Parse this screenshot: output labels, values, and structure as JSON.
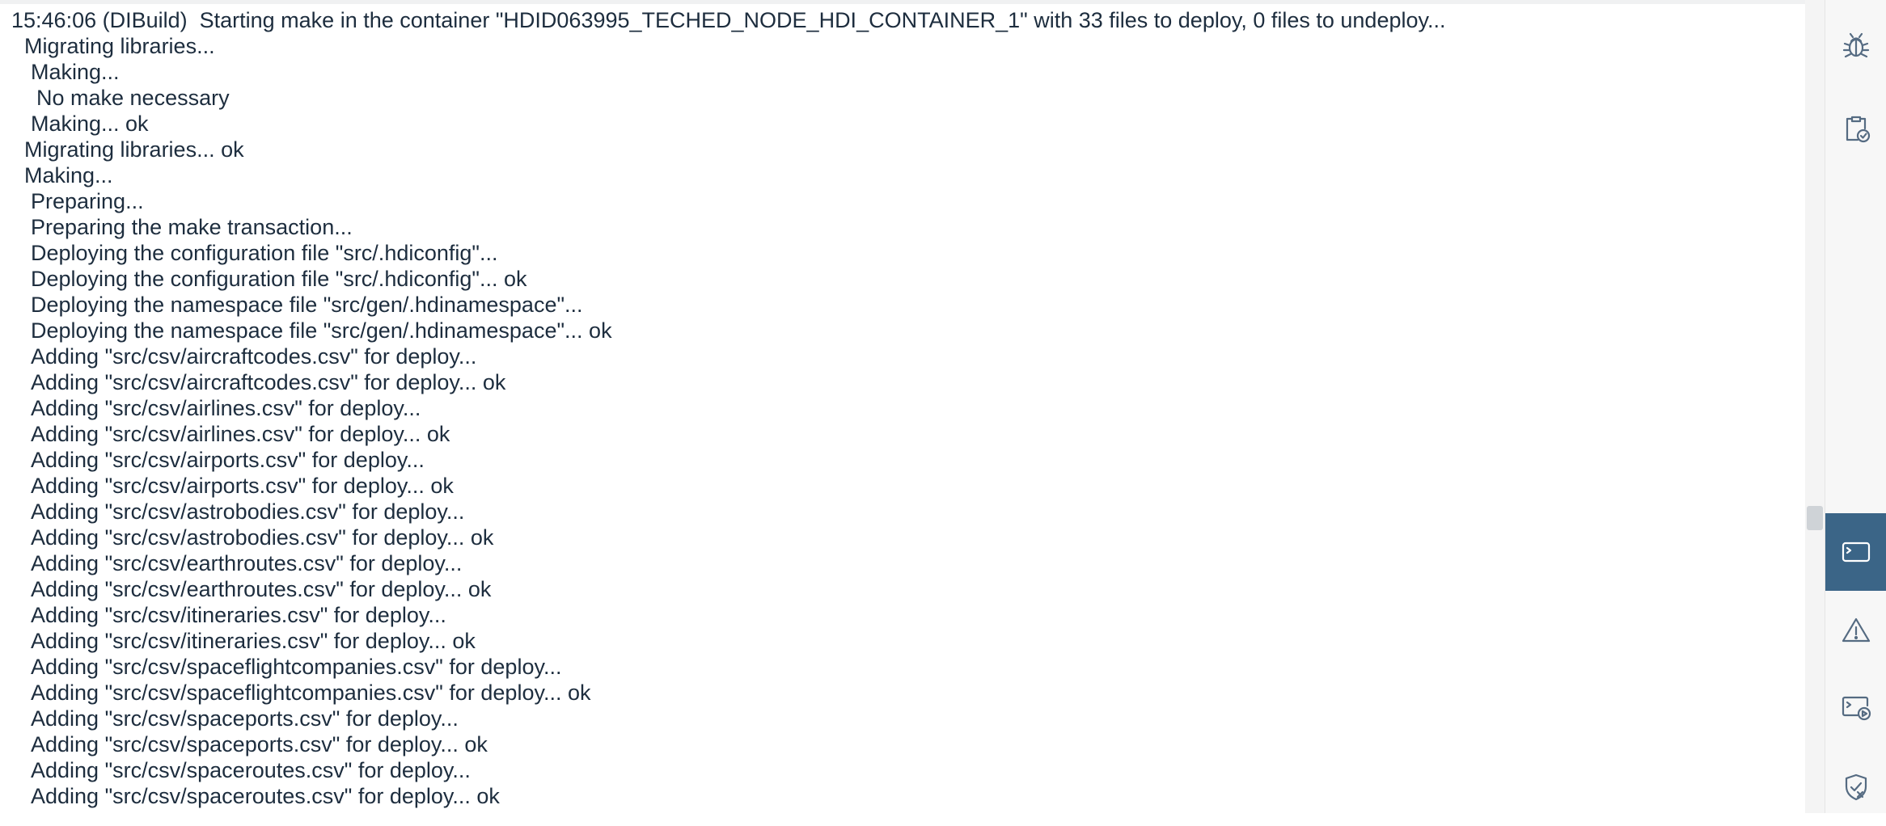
{
  "console": {
    "lines": [
      {
        "text": "15:46:06 (DIBuild)  Starting make in the container \"HDID063995_TECHED_NODE_HDI_CONTAINER_1\" with 33 files to deploy, 0 files to undeploy...",
        "indent": 0
      },
      {
        "text": "Migrating libraries...",
        "indent": 1
      },
      {
        "text": "Making...",
        "indent": 2
      },
      {
        "text": "No make necessary",
        "indent": 3
      },
      {
        "text": "Making... ok",
        "indent": 2
      },
      {
        "text": "Migrating libraries... ok",
        "indent": 1
      },
      {
        "text": "Making...",
        "indent": 1
      },
      {
        "text": "Preparing...",
        "indent": 2
      },
      {
        "text": "Preparing the make transaction...",
        "indent": 2
      },
      {
        "text": "Deploying the configuration file \"src/.hdiconfig\"...",
        "indent": 2
      },
      {
        "text": "Deploying the configuration file \"src/.hdiconfig\"... ok",
        "indent": 2
      },
      {
        "text": "Deploying the namespace file \"src/gen/.hdinamespace\"...",
        "indent": 2
      },
      {
        "text": "Deploying the namespace file \"src/gen/.hdinamespace\"... ok",
        "indent": 2
      },
      {
        "text": "Adding \"src/csv/aircraftcodes.csv\" for deploy...",
        "indent": 2
      },
      {
        "text": "Adding \"src/csv/aircraftcodes.csv\" for deploy... ok",
        "indent": 2
      },
      {
        "text": "Adding \"src/csv/airlines.csv\" for deploy...",
        "indent": 2
      },
      {
        "text": "Adding \"src/csv/airlines.csv\" for deploy... ok",
        "indent": 2
      },
      {
        "text": "Adding \"src/csv/airports.csv\" for deploy...",
        "indent": 2
      },
      {
        "text": "Adding \"src/csv/airports.csv\" for deploy... ok",
        "indent": 2
      },
      {
        "text": "Adding \"src/csv/astrobodies.csv\" for deploy...",
        "indent": 2
      },
      {
        "text": "Adding \"src/csv/astrobodies.csv\" for deploy... ok",
        "indent": 2
      },
      {
        "text": "Adding \"src/csv/earthroutes.csv\" for deploy...",
        "indent": 2
      },
      {
        "text": "Adding \"src/csv/earthroutes.csv\" for deploy... ok",
        "indent": 2
      },
      {
        "text": "Adding \"src/csv/itineraries.csv\" for deploy...",
        "indent": 2
      },
      {
        "text": "Adding \"src/csv/itineraries.csv\" for deploy... ok",
        "indent": 2
      },
      {
        "text": "Adding \"src/csv/spaceflightcompanies.csv\" for deploy...",
        "indent": 2
      },
      {
        "text": "Adding \"src/csv/spaceflightcompanies.csv\" for deploy... ok",
        "indent": 2
      },
      {
        "text": "Adding \"src/csv/spaceports.csv\" for deploy...",
        "indent": 2
      },
      {
        "text": "Adding \"src/csv/spaceports.csv\" for deploy... ok",
        "indent": 2
      },
      {
        "text": "Adding \"src/csv/spaceroutes.csv\" for deploy...",
        "indent": 2
      },
      {
        "text": "Adding \"src/csv/spaceroutes.csv\" for deploy... ok",
        "indent": 2
      }
    ]
  },
  "right_sidebar": {
    "items": [
      {
        "icon": "bug-icon",
        "active": false
      },
      {
        "icon": "clipboard-check-icon",
        "active": false
      },
      {
        "icon": "terminal-icon",
        "active": true
      },
      {
        "icon": "warning-icon",
        "active": false
      },
      {
        "icon": "run-console-icon",
        "active": false
      },
      {
        "icon": "shield-check-icon",
        "active": false
      }
    ]
  },
  "colors": {
    "text": "#1d2d3e",
    "active_tab": "#3b6587",
    "icon": "#556b82"
  }
}
